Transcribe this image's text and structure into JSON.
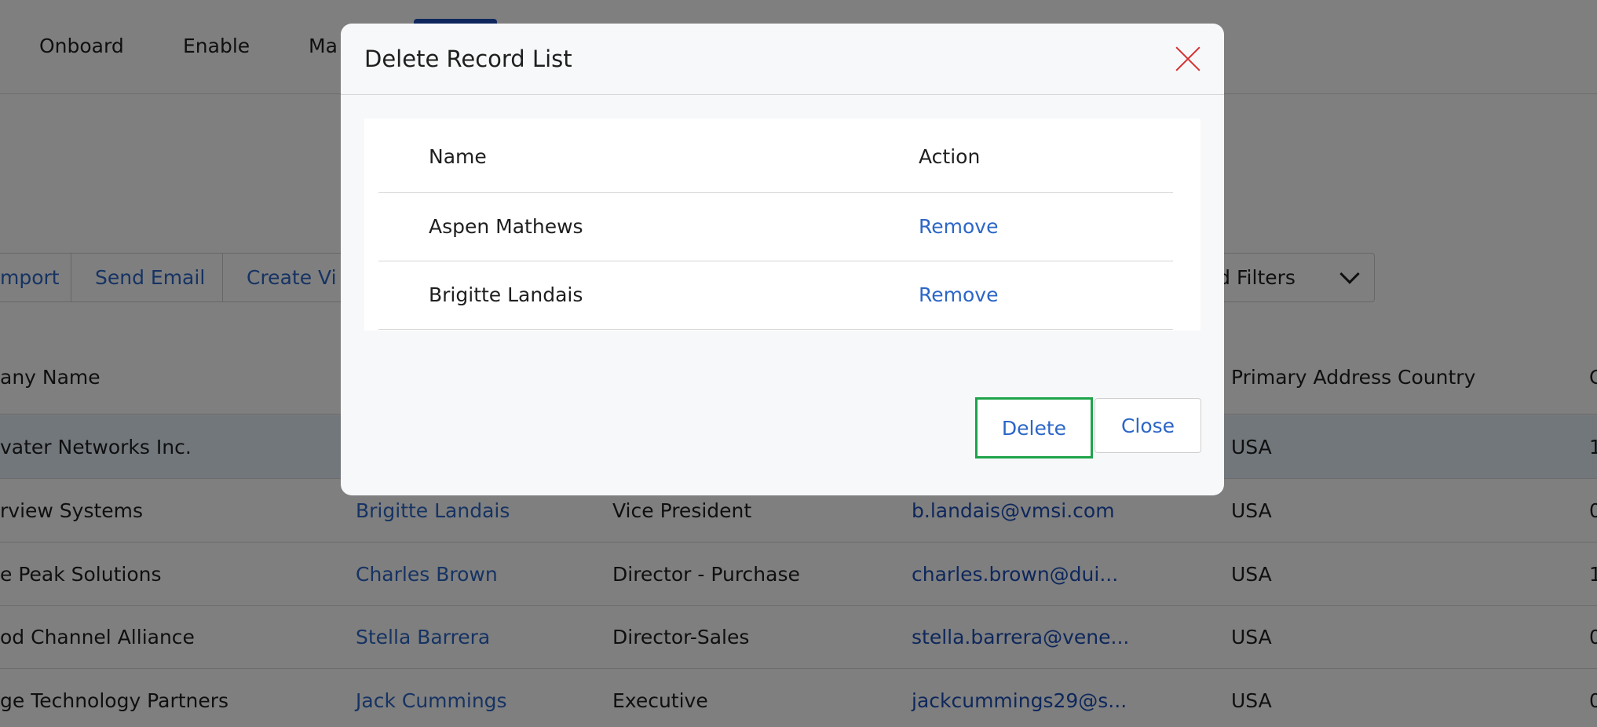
{
  "nav": {
    "items": [
      "Onboard",
      "Enable",
      "Ma"
    ]
  },
  "toolbar": {
    "import_label": "mport",
    "send_email_label": "Send Email",
    "create_view_label": "Create Vi"
  },
  "filters": {
    "label": "ved Filters"
  },
  "table": {
    "headers": {
      "company": "any Name",
      "country": "Primary Address Country",
      "extra": "C"
    },
    "rows": [
      {
        "company": "vater Networks Inc.",
        "name": "",
        "title": "",
        "email": "",
        "country": "USA",
        "extra": "1"
      },
      {
        "company": "rview Systems",
        "name": "Brigitte Landais",
        "title": "Vice President",
        "email": "b.landais@vmsi.com",
        "country": "USA",
        "extra": "0"
      },
      {
        "company": "e Peak Solutions",
        "name": "Charles Brown",
        "title": "Director - Purchase",
        "email": "charles.brown@dui...",
        "country": "USA",
        "extra": "1"
      },
      {
        "company": "od Channel Alliance",
        "name": "Stella Barrera",
        "title": "Director-Sales",
        "email": "stella.barrera@vene...",
        "country": "USA",
        "extra": "0"
      },
      {
        "company": "ge Technology Partners",
        "name": "Jack Cummings",
        "title": "Executive",
        "email": "jackcummings29@s...",
        "country": "USA",
        "extra": "0"
      }
    ]
  },
  "modal": {
    "title": "Delete Record List",
    "columns": {
      "name": "Name",
      "action": "Action"
    },
    "records": [
      {
        "name": "Aspen Mathews",
        "action": "Remove"
      },
      {
        "name": "Brigitte Landais",
        "action": "Remove"
      }
    ],
    "delete_label": "Delete",
    "close_label": "Close"
  },
  "colors": {
    "accent_link": "#2c66c7",
    "close_icon": "#d32f2f",
    "focus_border": "#1fa34a",
    "active_tab": "#1d4fb8"
  }
}
